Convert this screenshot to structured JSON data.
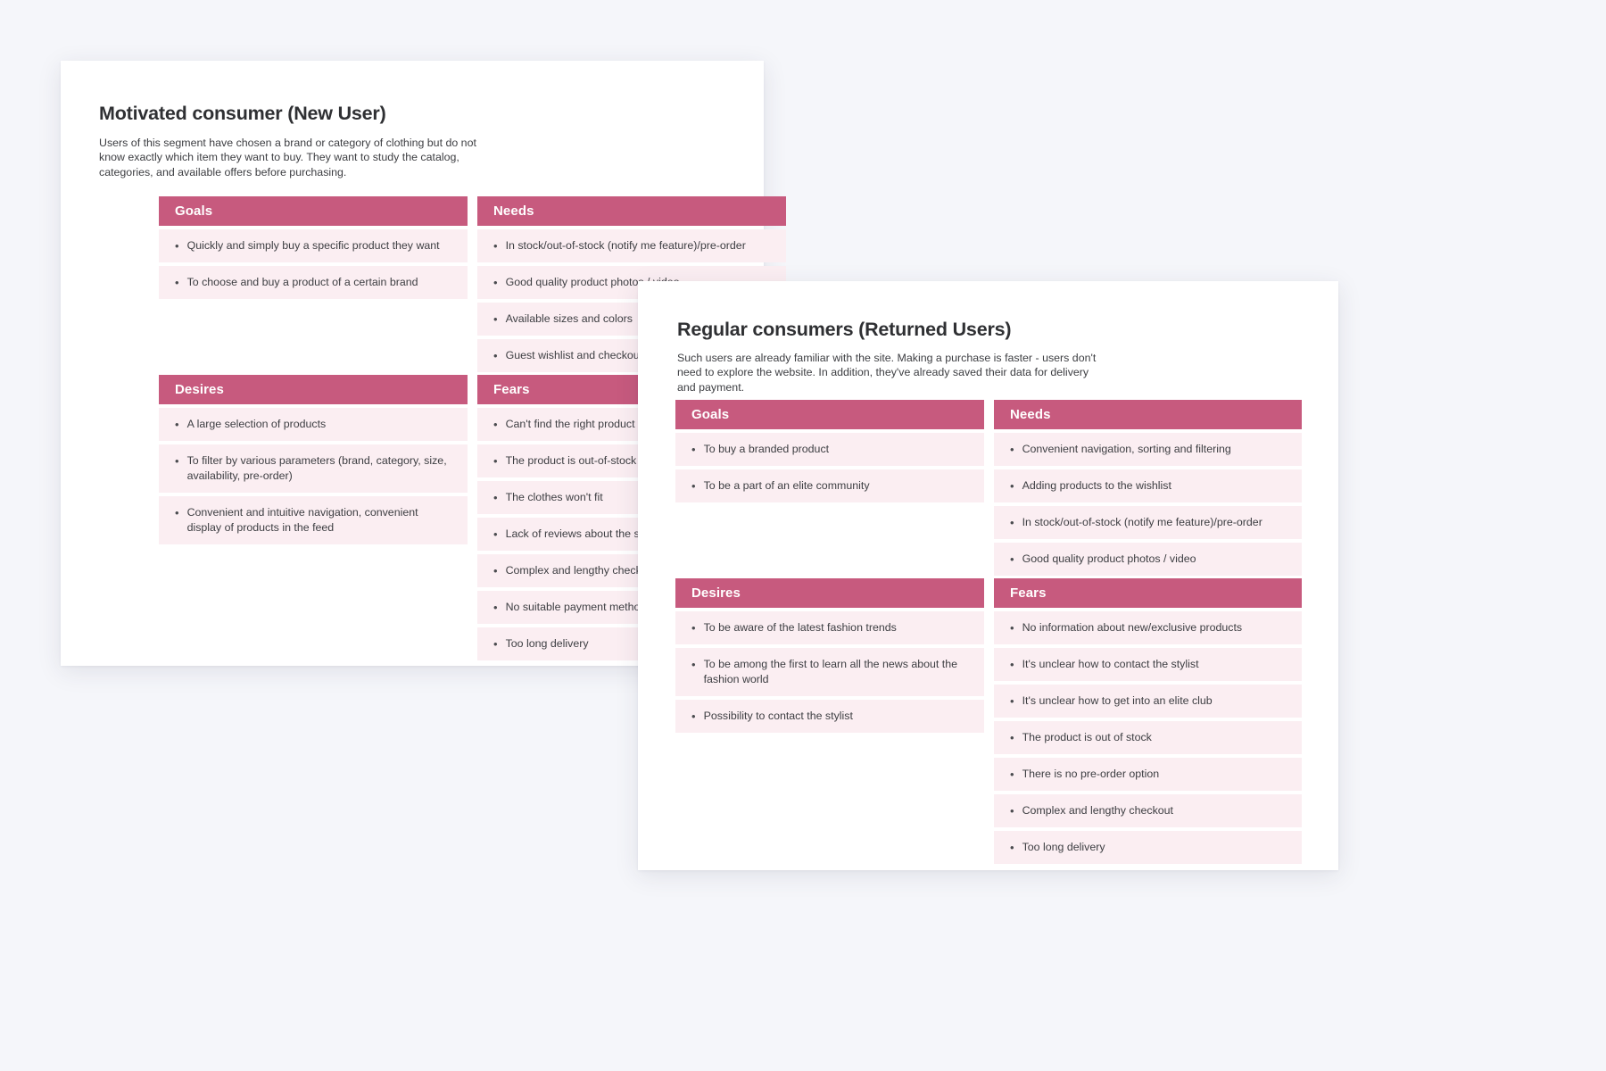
{
  "cards": [
    {
      "title": "Motivated consumer (New User)",
      "description": "Users of this segment have chosen a brand or category of clothing but do not know exactly which item they want to buy. They want to study the catalog, categories, and available offers before purchasing.",
      "sections": {
        "goals": {
          "header": "Goals",
          "items": [
            "Quickly and simply buy a specific product they want",
            "To choose and buy a product of a certain brand"
          ]
        },
        "needs": {
          "header": "Needs",
          "items": [
            "In stock/out-of-stock (notify me feature)/pre-order",
            "Good quality product photos / video",
            "Available sizes and colors",
            "Guest wishlist and checkout"
          ]
        },
        "desires": {
          "header": "Desires",
          "items": [
            "A large selection of products",
            "To filter by various parameters (brand, category, size, availability, pre-order)",
            "Convenient and intuitive navigation, convenient display of products in the feed"
          ]
        },
        "fears": {
          "header": "Fears",
          "items": [
            "Can't find the right product",
            "The product is out-of-stock",
            "The clothes won't fit",
            "Lack of reviews about the store",
            "Complex and lengthy checkout",
            "No suitable payment method",
            "Too long delivery"
          ]
        }
      }
    },
    {
      "title": "Regular consumers (Returned Users)",
      "description": "Such users are already familiar with the site. Making a purchase is faster - users don't need to explore the website. In addition, they've already saved their data for delivery and payment.",
      "sections": {
        "goals": {
          "header": "Goals",
          "items": [
            "To buy a branded product",
            "To be a part of an elite community"
          ]
        },
        "needs": {
          "header": "Needs",
          "items": [
            "Convenient navigation, sorting and filtering",
            "Adding products to the wishlist",
            "In stock/out-of-stock (notify me feature)/pre-order",
            "Good quality product photos / video"
          ]
        },
        "desires": {
          "header": "Desires",
          "items": [
            "To be aware of the latest fashion trends",
            "To be among the first to learn all the news about the fashion world",
            "Possibility to contact the stylist"
          ]
        },
        "fears": {
          "header": "Fears",
          "items": [
            "No information about new/exclusive products",
            "It's unclear how to contact the stylist",
            "It's unclear how to get into an elite club",
            "The product is out of stock",
            "There is no pre-order option",
            "Complex and lengthy checkout",
            "Too long delivery"
          ]
        }
      }
    }
  ],
  "bullet_glyph": "•",
  "colors": {
    "page_background": "#f5f6fa",
    "card_background": "#ffffff",
    "header_accent": "#c75a7e",
    "row_background": "#fbeef2",
    "title_text": "#2f3033",
    "body_text": "#3d3e42"
  }
}
